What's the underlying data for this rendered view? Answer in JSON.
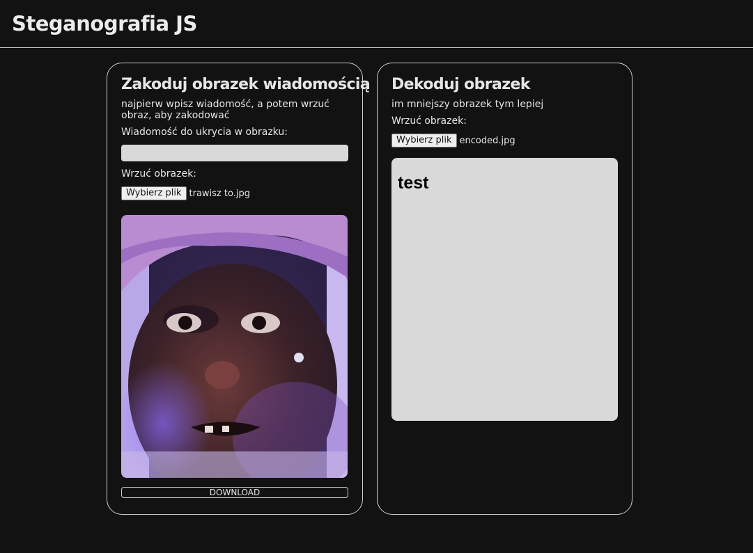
{
  "header": {
    "title": "Steganografia JS"
  },
  "encode": {
    "title": "Zakoduj obrazek wiadomością",
    "description": "najpierw wpisz wiadomość, a potem wrzuć obraz, aby zakodować",
    "message_label": "Wiadomość do ukrycia w obrazku:",
    "message_value": "",
    "upload_label": "Wrzuć obrazek:",
    "file_button": "Wybierz plik",
    "file_name": "trawisz to.jpg",
    "download_label": "DOWNLOAD"
  },
  "decode": {
    "title": "Dekoduj obrazek",
    "description": "im mniejszy obrazek tym lepiej",
    "upload_label": "Wrzuć obrazek:",
    "file_button": "Wybierz plik",
    "file_name": "encoded.jpg",
    "decoded_text": "test"
  }
}
